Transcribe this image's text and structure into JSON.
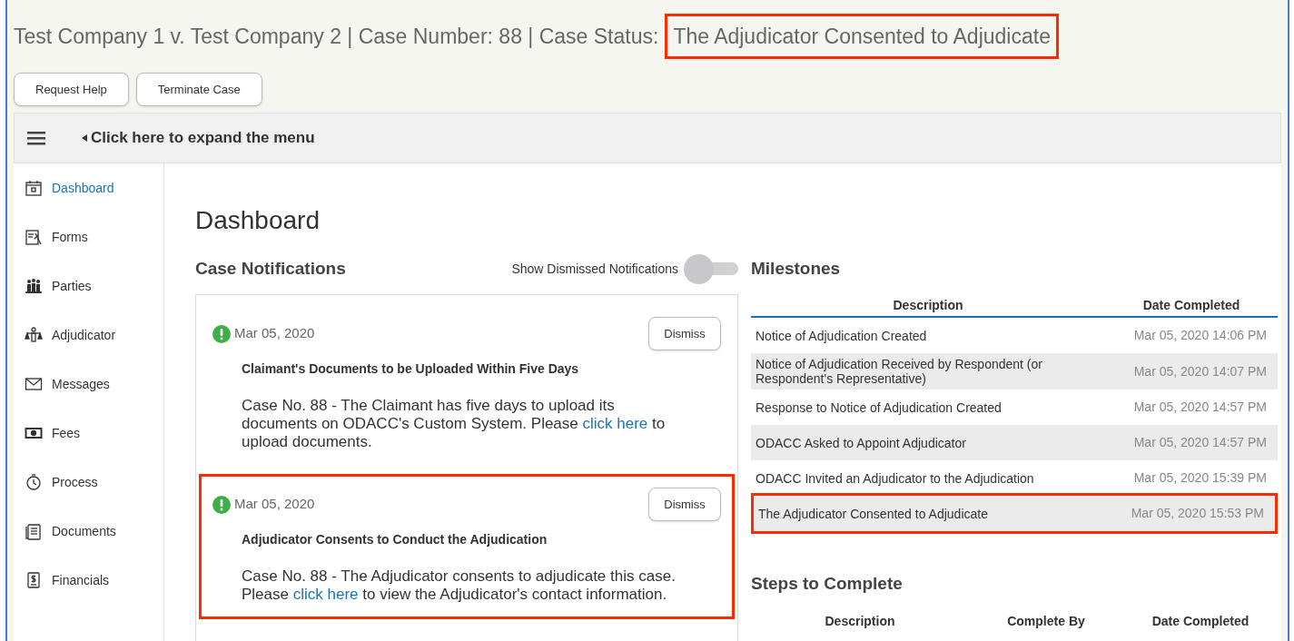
{
  "header": {
    "case_title": "Test Company 1 v. Test Company 2 | Case Number: 88 | Case Status:",
    "status": "The Adjudicator Consented to Adjudicate",
    "status_highlighted": true
  },
  "actions": [
    "Request Help",
    "Terminate Case"
  ],
  "menu_bar": {
    "label": "Click here to expand the menu"
  },
  "sidebar": {
    "items": [
      {
        "label": "Dashboard",
        "kind": "calendar",
        "selected": true
      },
      {
        "label": "Forms",
        "kind": "form",
        "selected": false
      },
      {
        "label": "Parties",
        "kind": "people",
        "selected": false
      },
      {
        "label": "Adjudicator",
        "kind": "scales",
        "selected": false
      },
      {
        "label": "Messages",
        "kind": "mail",
        "selected": false
      },
      {
        "label": "Fees",
        "kind": "money",
        "selected": false
      },
      {
        "label": "Process",
        "kind": "timer",
        "selected": false
      },
      {
        "label": "Documents",
        "kind": "document",
        "selected": false
      },
      {
        "label": "Financials",
        "kind": "dollar",
        "selected": false
      }
    ]
  },
  "page_title": "Dashboard",
  "notifications": {
    "title": "Case Notifications",
    "toggle_label": "Show Dismissed Notifications",
    "toggle_on": false,
    "items": [
      {
        "date": "Mar 05, 2020",
        "dismiss": "Dismiss",
        "heading": "Claimant's Documents to be Uploaded Within Five Days",
        "text_before": "Case No. 88 - The Claimant has five days to upload its documents on ODACC's Custom System. Please",
        "link": "click here",
        "text_after": "to upload documents.",
        "highlighted": false
      },
      {
        "date": "Mar 05, 2020",
        "dismiss": "Dismiss",
        "heading": "Adjudicator Consents to Conduct the Adjudication",
        "text_before": "Case No. 88 - The Adjudicator consents to adjudicate this case. Please",
        "link": "click here",
        "text_after": "to view the Adjudicator's contact information.",
        "highlighted": true
      }
    ]
  },
  "milestones": {
    "title": "Milestones",
    "columns": [
      "Description",
      "Date Completed"
    ],
    "rows": [
      {
        "description": "Notice of Adjudication Created",
        "date": "Mar 05, 2020 14:06 PM",
        "highlighted": false
      },
      {
        "description": "Notice of Adjudication Received by Respondent (or Respondent's Representative)",
        "date": "Mar 05, 2020 14:07 PM",
        "highlighted": false
      },
      {
        "description": "Response to Notice of Adjudication Created",
        "date": "Mar 05, 2020 14:57 PM",
        "highlighted": false
      },
      {
        "description": "ODACC Asked to Appoint Adjudicator",
        "date": "Mar 05, 2020 14:57 PM",
        "highlighted": false
      },
      {
        "description": "ODACC Invited an Adjudicator to the Adjudication",
        "date": "Mar 05, 2020 15:39 PM",
        "highlighted": false
      },
      {
        "description": "The Adjudicator Consented to Adjudicate",
        "date": "Mar 05, 2020 15:53 PM",
        "highlighted": true
      }
    ]
  },
  "steps": {
    "title": "Steps to Complete",
    "columns": [
      "Description",
      "Complete By",
      "Date Completed"
    ]
  }
}
